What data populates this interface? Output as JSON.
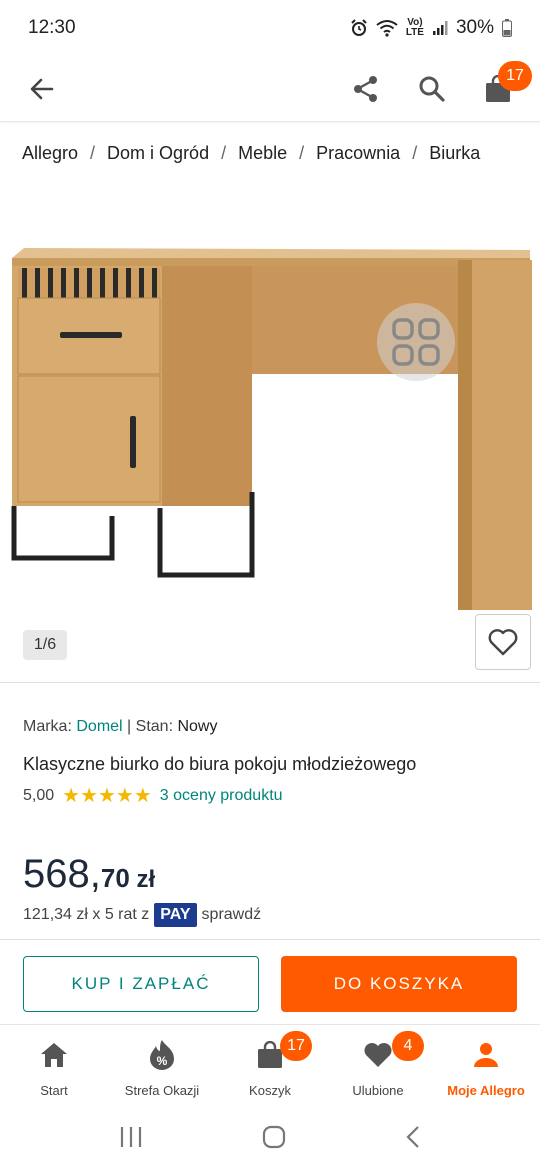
{
  "status_bar": {
    "time": "12:30",
    "network_top": "Vo)",
    "network_bottom": "LTE",
    "battery": "30%"
  },
  "header": {
    "cart_count": "17",
    "icons": [
      "back-arrow-icon",
      "share-icon",
      "search-icon",
      "shopping-bag-icon"
    ]
  },
  "breadcrumb": [
    "Allegro",
    "Dom i Ogród",
    "Meble",
    "Pracownia",
    "Biurka"
  ],
  "breadcrumb_separator": "/",
  "gallery": {
    "counter": "1/6"
  },
  "product": {
    "brand_label": "Marka:",
    "brand": "Domel",
    "condition_label": "| Stan:",
    "condition": "Nowy",
    "title": "Klasyczne biurko do biura pokoju młodzieżowego",
    "rating": "5,00",
    "stars": "★★★★★",
    "rating_count": "3 oceny produktu",
    "price_int": "568,",
    "price_dec": "70",
    "currency": " zł",
    "installments": "121,34 zł x 5 rat z",
    "pay_label": "PAY",
    "check_label": "sprawdź"
  },
  "actions": {
    "buy_label": "KUP I ZAPŁAĆ",
    "cart_label": "DO KOSZYKA"
  },
  "colors": {
    "accent": "#ff5a00",
    "teal": "#00857a",
    "price": "#1e2a3a",
    "pay": "#1d3c8f",
    "star": "#f5b800"
  },
  "bottom_nav": [
    {
      "label": "Start",
      "icon": "home-icon"
    },
    {
      "label": "Strefa Okazji",
      "icon": "deals-icon"
    },
    {
      "label": "Koszyk",
      "icon": "cart-icon",
      "badge": "17"
    },
    {
      "label": "Ulubione",
      "icon": "heart-icon",
      "badge": "4"
    },
    {
      "label": "Moje Allegro",
      "icon": "user-icon"
    }
  ]
}
